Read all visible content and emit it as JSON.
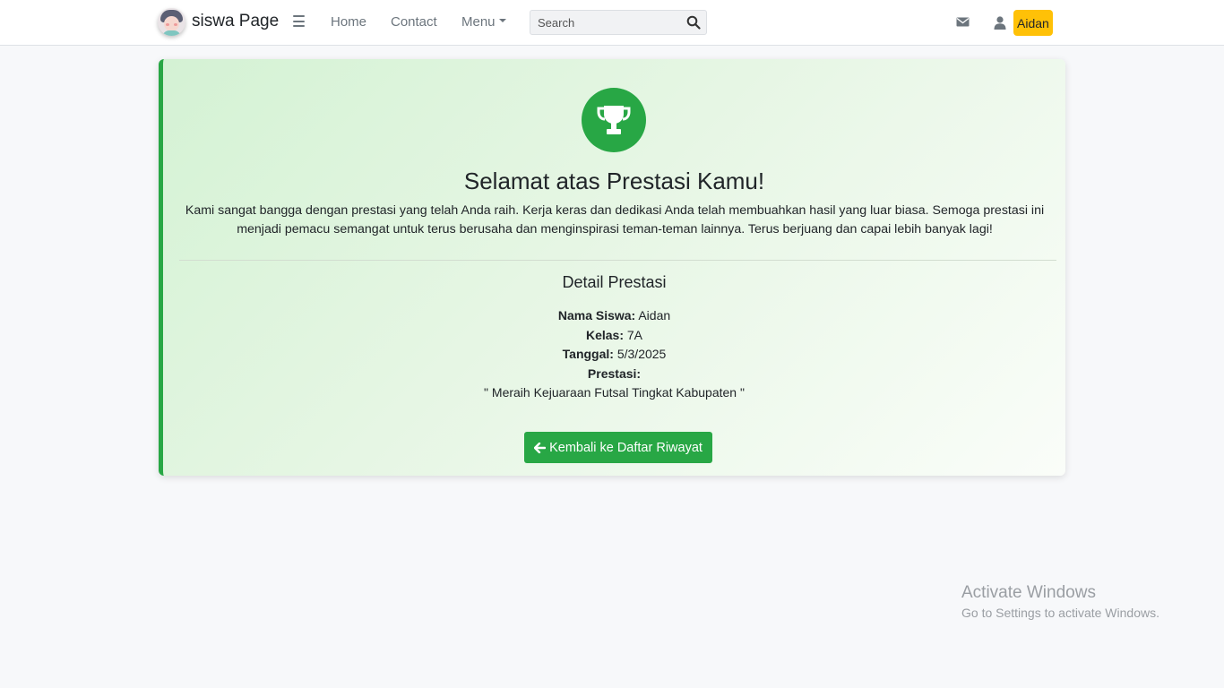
{
  "navbar": {
    "brand": "siswa Page",
    "links": {
      "home": "Home",
      "contact": "Contact",
      "menu": "Menu"
    },
    "search": {
      "placeholder": "Search",
      "value": ""
    },
    "user_name": "Aidan",
    "icons": [
      "hamburger-icon",
      "search-icon",
      "envelope-icon",
      "user-icon"
    ]
  },
  "card": {
    "title": "Selamat atas Prestasi Kamu!",
    "message": "Kami sangat bangga dengan prestasi yang telah Anda raih. Kerja keras dan dedikasi Anda telah membuahkan hasil yang luar biasa. Semoga prestasi ini menjadi pemacu semangat untuk terus berusaha dan menginspirasi teman-teman lainnya. Terus berjuang dan capai lebih banyak lagi!",
    "detail_title": "Detail Prestasi",
    "details": {
      "nama_label": "Nama Siswa:",
      "nama_value": "Aidan",
      "kelas_label": "Kelas:",
      "kelas_value": "7A",
      "tanggal_label": "Tanggal:",
      "tanggal_value": "5/3/2025",
      "prestasi_label": "Prestasi:",
      "prestasi_value": "\" Meraih Kejuaraan Futsal Tingkat Kabupaten \""
    },
    "back_button": "Kembali ke Daftar Riwayat",
    "icon": "trophy-icon"
  },
  "watermark": {
    "title": "Activate Windows",
    "subtitle": "Go to Settings to activate Windows."
  },
  "colors": {
    "accent": "#28a745",
    "badge": "#ffc107",
    "background": "#f7f8fa"
  }
}
